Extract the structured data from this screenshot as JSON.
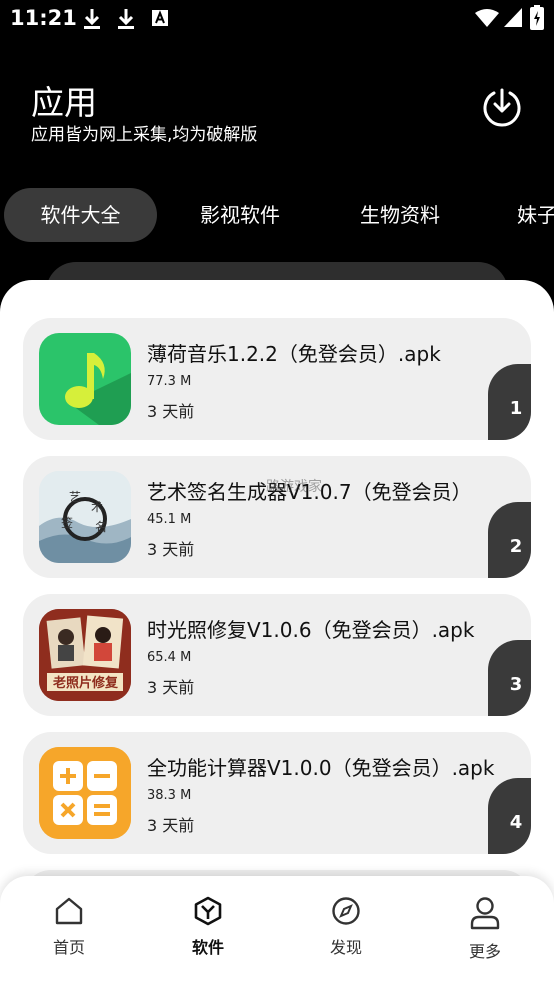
{
  "status_bar": {
    "time": "11:21",
    "icons": [
      "download-icon",
      "download-icon",
      "font-a-icon",
      "wifi-icon",
      "signal-icon",
      "battery-icon"
    ]
  },
  "header": {
    "title": "应用",
    "subtitle": "应用皆为网上采集,均为破解版",
    "action_icon": "download-circle-icon"
  },
  "tabs": [
    {
      "label": "软件大全",
      "active": true
    },
    {
      "label": "影视软件",
      "active": false
    },
    {
      "label": "生物资料",
      "active": false
    },
    {
      "label": "妹子",
      "active": false
    }
  ],
  "apps": [
    {
      "name": "薄荷音乐1.2.2（免登会员）.apk",
      "size": "77.3 M",
      "time": "3 天前",
      "rank": "1",
      "icon": "music-note-icon"
    },
    {
      "name": "艺术签名生成器V1.0.7（免登会员）",
      "size": "45.1 M",
      "time": "3 天前",
      "rank": "2",
      "icon": "art-signature-icon"
    },
    {
      "name": "时光照修复V1.0.6（免登会员）.apk",
      "size": "65.4 M",
      "time": "3 天前",
      "rank": "3",
      "icon": "old-photo-icon"
    },
    {
      "name": "全功能计算器V1.0.0（免登会员）.apk",
      "size": "38.3 M",
      "time": "3 天前",
      "rank": "4",
      "icon": "calculator-icon"
    }
  ],
  "watermark": "路游戏家",
  "bottom_nav": [
    {
      "label": "首页",
      "icon": "home-icon",
      "active": false
    },
    {
      "label": "软件",
      "icon": "software-icon",
      "active": true
    },
    {
      "label": "发现",
      "icon": "compass-icon",
      "active": false
    },
    {
      "label": "更多",
      "icon": "user-icon",
      "active": false
    }
  ],
  "colors": {
    "background": "#000000",
    "sheet": "#ffffff",
    "card": "#efefef",
    "active_tab": "#3a3a3a",
    "rank_badge": "#3a3a3a"
  }
}
